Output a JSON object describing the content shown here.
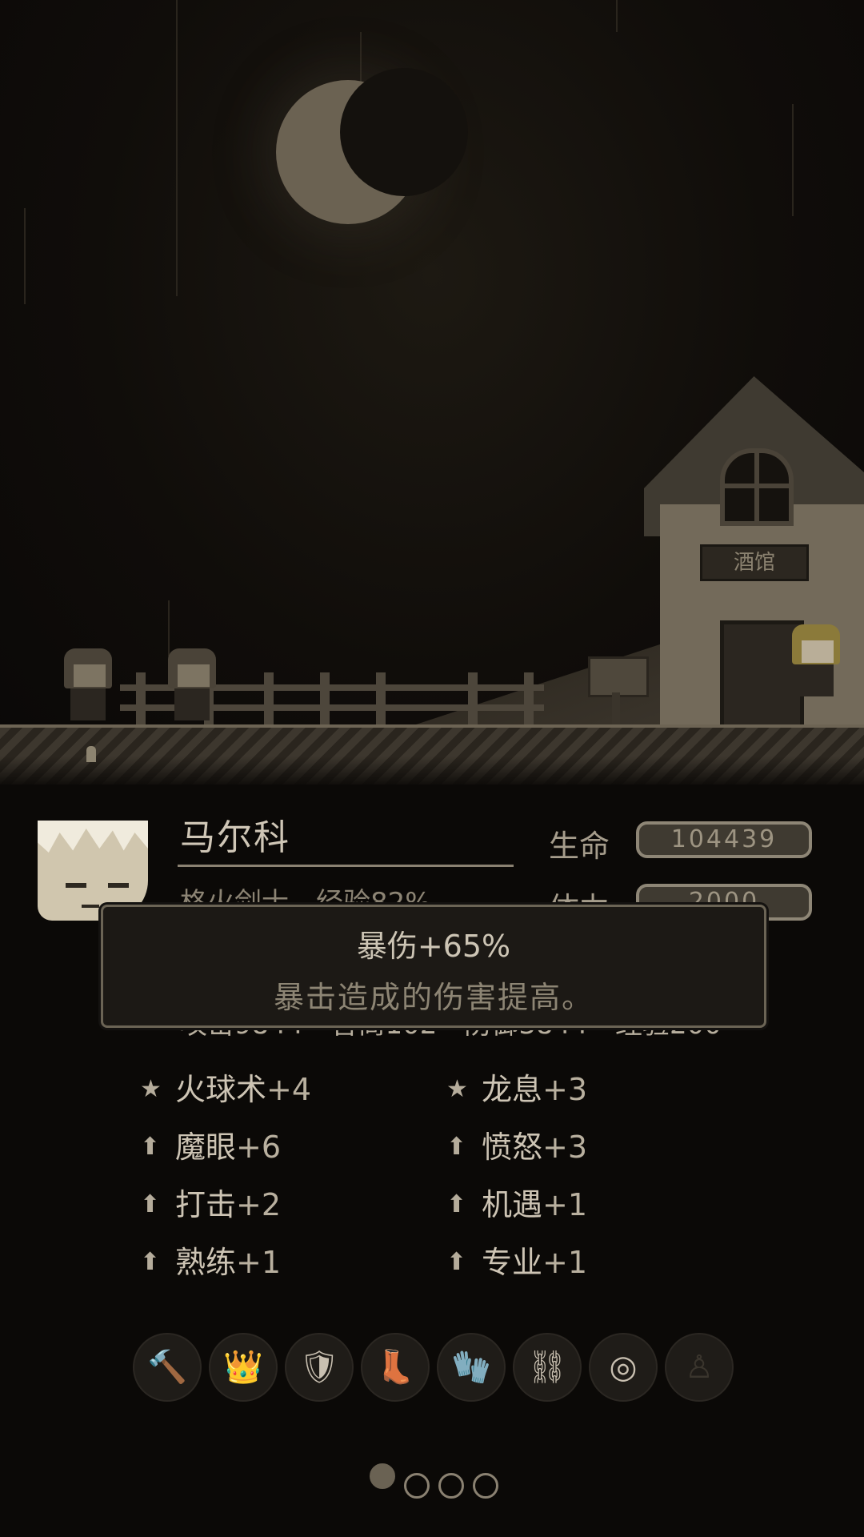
{
  "scene": {
    "tavern_sign": "酒馆"
  },
  "character": {
    "name": "马尔科",
    "subtitle": "格火剑士　经验82%",
    "stats": [
      {
        "label": "生命",
        "value": "104439"
      },
      {
        "label": "体力",
        "value": "2000"
      }
    ],
    "attr_line": "攻击9844　智商102　防御3844　经验200"
  },
  "tooltip": {
    "title": "暴伤+65%",
    "description": "暴击造成的伤害提高。"
  },
  "skills": {
    "left": [
      {
        "icon": "star-icon",
        "name": "火球术",
        "level": "+4",
        "highlight": 0.2
      },
      {
        "icon": "arrow-up-icon",
        "name": "魔眼",
        "level": "+6",
        "highlight": 0.2
      },
      {
        "icon": "arrow-up-icon",
        "name": "打击",
        "level": "+2",
        "highlight": 0.5
      },
      {
        "icon": "arrow-up-icon",
        "name": "熟练",
        "level": "+1",
        "highlight": 0.9
      }
    ],
    "right": [
      {
        "icon": "star-icon",
        "name": "龙息",
        "level": "+3",
        "highlight": 1.0
      },
      {
        "icon": "arrow-up-icon",
        "name": "愤怒",
        "level": "+3",
        "highlight": 0.6
      },
      {
        "icon": "arrow-up-icon",
        "name": "机遇",
        "level": "+1",
        "highlight": 1.0
      },
      {
        "icon": "arrow-up-icon",
        "name": "专业",
        "level": "+1",
        "highlight": 0.4
      }
    ]
  },
  "equipment": [
    {
      "icon": "hammer-icon",
      "glyph": "🔨"
    },
    {
      "icon": "crown-icon",
      "glyph": "👑"
    },
    {
      "icon": "armor-icon",
      "glyph": "🛡"
    },
    {
      "icon": "boots-icon",
      "glyph": "👢"
    },
    {
      "icon": "gauntlet-icon",
      "glyph": "🧤"
    },
    {
      "icon": "greaves-icon",
      "glyph": "⛓"
    },
    {
      "icon": "ring-icon",
      "glyph": "◎"
    },
    {
      "icon": "empty-slot-icon",
      "glyph": "♙"
    }
  ],
  "pager": {
    "pages": 4,
    "current": 1
  }
}
